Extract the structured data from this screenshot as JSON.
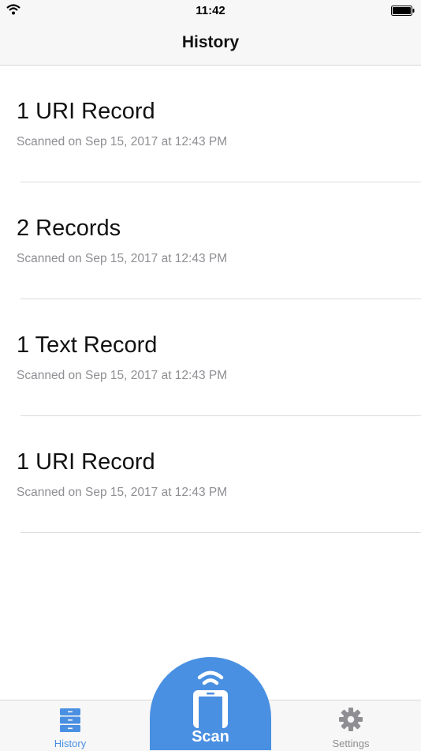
{
  "status_bar": {
    "time": "11:42",
    "icons": [
      "wifi-icon",
      "battery-icon"
    ]
  },
  "nav": {
    "title": "History"
  },
  "history": {
    "items": [
      {
        "title": "1 URI Record",
        "subtitle": "Scanned on Sep 15, 2017 at 12:43 PM"
      },
      {
        "title": "2 Records",
        "subtitle": "Scanned on Sep 15, 2017 at 12:43 PM"
      },
      {
        "title": "1 Text Record",
        "subtitle": "Scanned on Sep 15, 2017 at 12:43 PM"
      },
      {
        "title": "1 URI Record",
        "subtitle": "Scanned on Sep 15, 2017 at 12:43 PM"
      }
    ]
  },
  "tab_bar": {
    "history_label": "History",
    "scan_label": "Scan",
    "settings_label": "Settings",
    "icons": [
      "drawer-icon",
      "nfc-scan-icon",
      "gear-icon"
    ]
  },
  "colors": {
    "accent": "#4a90e2",
    "inactive": "#8e8e93",
    "bar_background": "#f7f7f7"
  }
}
